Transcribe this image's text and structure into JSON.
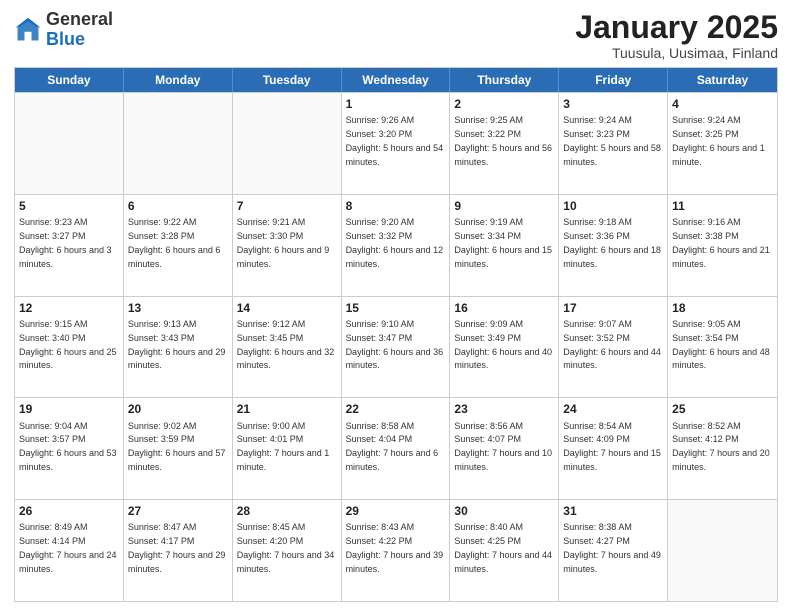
{
  "header": {
    "logo_general": "General",
    "logo_blue": "Blue",
    "month_title": "January 2025",
    "subtitle": "Tuusula, Uusimaa, Finland"
  },
  "weekdays": [
    "Sunday",
    "Monday",
    "Tuesday",
    "Wednesday",
    "Thursday",
    "Friday",
    "Saturday"
  ],
  "weeks": [
    [
      {
        "day": "",
        "sunrise": "",
        "sunset": "",
        "daylight": "",
        "empty": true
      },
      {
        "day": "",
        "sunrise": "",
        "sunset": "",
        "daylight": "",
        "empty": true
      },
      {
        "day": "",
        "sunrise": "",
        "sunset": "",
        "daylight": "",
        "empty": true
      },
      {
        "day": "1",
        "sunrise": "Sunrise: 9:26 AM",
        "sunset": "Sunset: 3:20 PM",
        "daylight": "Daylight: 5 hours and 54 minutes.",
        "empty": false
      },
      {
        "day": "2",
        "sunrise": "Sunrise: 9:25 AM",
        "sunset": "Sunset: 3:22 PM",
        "daylight": "Daylight: 5 hours and 56 minutes.",
        "empty": false
      },
      {
        "day": "3",
        "sunrise": "Sunrise: 9:24 AM",
        "sunset": "Sunset: 3:23 PM",
        "daylight": "Daylight: 5 hours and 58 minutes.",
        "empty": false
      },
      {
        "day": "4",
        "sunrise": "Sunrise: 9:24 AM",
        "sunset": "Sunset: 3:25 PM",
        "daylight": "Daylight: 6 hours and 1 minute.",
        "empty": false
      }
    ],
    [
      {
        "day": "5",
        "sunrise": "Sunrise: 9:23 AM",
        "sunset": "Sunset: 3:27 PM",
        "daylight": "Daylight: 6 hours and 3 minutes.",
        "empty": false
      },
      {
        "day": "6",
        "sunrise": "Sunrise: 9:22 AM",
        "sunset": "Sunset: 3:28 PM",
        "daylight": "Daylight: 6 hours and 6 minutes.",
        "empty": false
      },
      {
        "day": "7",
        "sunrise": "Sunrise: 9:21 AM",
        "sunset": "Sunset: 3:30 PM",
        "daylight": "Daylight: 6 hours and 9 minutes.",
        "empty": false
      },
      {
        "day": "8",
        "sunrise": "Sunrise: 9:20 AM",
        "sunset": "Sunset: 3:32 PM",
        "daylight": "Daylight: 6 hours and 12 minutes.",
        "empty": false
      },
      {
        "day": "9",
        "sunrise": "Sunrise: 9:19 AM",
        "sunset": "Sunset: 3:34 PM",
        "daylight": "Daylight: 6 hours and 15 minutes.",
        "empty": false
      },
      {
        "day": "10",
        "sunrise": "Sunrise: 9:18 AM",
        "sunset": "Sunset: 3:36 PM",
        "daylight": "Daylight: 6 hours and 18 minutes.",
        "empty": false
      },
      {
        "day": "11",
        "sunrise": "Sunrise: 9:16 AM",
        "sunset": "Sunset: 3:38 PM",
        "daylight": "Daylight: 6 hours and 21 minutes.",
        "empty": false
      }
    ],
    [
      {
        "day": "12",
        "sunrise": "Sunrise: 9:15 AM",
        "sunset": "Sunset: 3:40 PM",
        "daylight": "Daylight: 6 hours and 25 minutes.",
        "empty": false
      },
      {
        "day": "13",
        "sunrise": "Sunrise: 9:13 AM",
        "sunset": "Sunset: 3:43 PM",
        "daylight": "Daylight: 6 hours and 29 minutes.",
        "empty": false
      },
      {
        "day": "14",
        "sunrise": "Sunrise: 9:12 AM",
        "sunset": "Sunset: 3:45 PM",
        "daylight": "Daylight: 6 hours and 32 minutes.",
        "empty": false
      },
      {
        "day": "15",
        "sunrise": "Sunrise: 9:10 AM",
        "sunset": "Sunset: 3:47 PM",
        "daylight": "Daylight: 6 hours and 36 minutes.",
        "empty": false
      },
      {
        "day": "16",
        "sunrise": "Sunrise: 9:09 AM",
        "sunset": "Sunset: 3:49 PM",
        "daylight": "Daylight: 6 hours and 40 minutes.",
        "empty": false
      },
      {
        "day": "17",
        "sunrise": "Sunrise: 9:07 AM",
        "sunset": "Sunset: 3:52 PM",
        "daylight": "Daylight: 6 hours and 44 minutes.",
        "empty": false
      },
      {
        "day": "18",
        "sunrise": "Sunrise: 9:05 AM",
        "sunset": "Sunset: 3:54 PM",
        "daylight": "Daylight: 6 hours and 48 minutes.",
        "empty": false
      }
    ],
    [
      {
        "day": "19",
        "sunrise": "Sunrise: 9:04 AM",
        "sunset": "Sunset: 3:57 PM",
        "daylight": "Daylight: 6 hours and 53 minutes.",
        "empty": false
      },
      {
        "day": "20",
        "sunrise": "Sunrise: 9:02 AM",
        "sunset": "Sunset: 3:59 PM",
        "daylight": "Daylight: 6 hours and 57 minutes.",
        "empty": false
      },
      {
        "day": "21",
        "sunrise": "Sunrise: 9:00 AM",
        "sunset": "Sunset: 4:01 PM",
        "daylight": "Daylight: 7 hours and 1 minute.",
        "empty": false
      },
      {
        "day": "22",
        "sunrise": "Sunrise: 8:58 AM",
        "sunset": "Sunset: 4:04 PM",
        "daylight": "Daylight: 7 hours and 6 minutes.",
        "empty": false
      },
      {
        "day": "23",
        "sunrise": "Sunrise: 8:56 AM",
        "sunset": "Sunset: 4:07 PM",
        "daylight": "Daylight: 7 hours and 10 minutes.",
        "empty": false
      },
      {
        "day": "24",
        "sunrise": "Sunrise: 8:54 AM",
        "sunset": "Sunset: 4:09 PM",
        "daylight": "Daylight: 7 hours and 15 minutes.",
        "empty": false
      },
      {
        "day": "25",
        "sunrise": "Sunrise: 8:52 AM",
        "sunset": "Sunset: 4:12 PM",
        "daylight": "Daylight: 7 hours and 20 minutes.",
        "empty": false
      }
    ],
    [
      {
        "day": "26",
        "sunrise": "Sunrise: 8:49 AM",
        "sunset": "Sunset: 4:14 PM",
        "daylight": "Daylight: 7 hours and 24 minutes.",
        "empty": false
      },
      {
        "day": "27",
        "sunrise": "Sunrise: 8:47 AM",
        "sunset": "Sunset: 4:17 PM",
        "daylight": "Daylight: 7 hours and 29 minutes.",
        "empty": false
      },
      {
        "day": "28",
        "sunrise": "Sunrise: 8:45 AM",
        "sunset": "Sunset: 4:20 PM",
        "daylight": "Daylight: 7 hours and 34 minutes.",
        "empty": false
      },
      {
        "day": "29",
        "sunrise": "Sunrise: 8:43 AM",
        "sunset": "Sunset: 4:22 PM",
        "daylight": "Daylight: 7 hours and 39 minutes.",
        "empty": false
      },
      {
        "day": "30",
        "sunrise": "Sunrise: 8:40 AM",
        "sunset": "Sunset: 4:25 PM",
        "daylight": "Daylight: 7 hours and 44 minutes.",
        "empty": false
      },
      {
        "day": "31",
        "sunrise": "Sunrise: 8:38 AM",
        "sunset": "Sunset: 4:27 PM",
        "daylight": "Daylight: 7 hours and 49 minutes.",
        "empty": false
      },
      {
        "day": "",
        "sunrise": "",
        "sunset": "",
        "daylight": "",
        "empty": true
      }
    ]
  ]
}
